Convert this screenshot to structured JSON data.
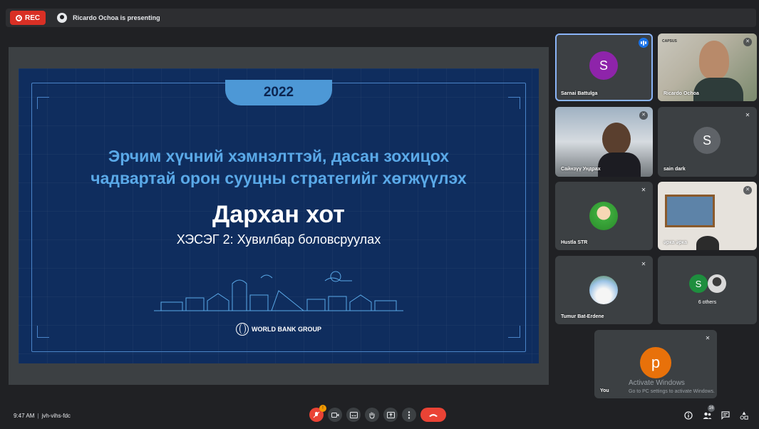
{
  "topbar": {
    "rec_label": "REC",
    "presenting_text": "Ricardo Ochoa is presenting"
  },
  "slide": {
    "year": "2022",
    "title_line1": "Эрчим хүчний хэмнэлттэй, дасан зохицох",
    "title_line2": "чадвартай орон сууцны стратегийг хөгжүүлэх",
    "city": "Дархан хот",
    "subtitle": "ХЭСЭГ 2: Хувилбар боловсруулах",
    "logo_text": "WORLD BANK GROUP"
  },
  "participants": [
    {
      "name": "Sarnai Battulga",
      "initial": "S",
      "avatar_color": "#8e24aa",
      "status": "speaking"
    },
    {
      "name": "Ricardo Ochoa",
      "status": "muted",
      "overlay_text": "CAPSUS"
    },
    {
      "name": "Сайнзүү Ундрах",
      "status": "muted"
    },
    {
      "name": "sain dark",
      "initial": "S",
      "avatar_color": "#5f6368",
      "status": "muted"
    },
    {
      "name": "Hustla STR",
      "status": "muted"
    },
    {
      "name": "әрка әрка",
      "status": "muted"
    },
    {
      "name": "Tumur Bat-Erdene",
      "status": "muted"
    },
    {
      "name": "6 others",
      "initial": "S",
      "avatar_color": "#1e8e3e"
    },
    {
      "name": "You",
      "initial": "p",
      "avatar_color": "#e8710a",
      "status": "muted"
    }
  ],
  "watermark": {
    "line1": "Activate Windows",
    "line2": "Go to PC settings to activate Windows."
  },
  "bottombar": {
    "time": "9:47 AM",
    "separator": "|",
    "meeting_code": "jvh-vihs-fdc",
    "mic_badge": "!",
    "people_count": "16"
  },
  "icons": {
    "mic": "mic-off-icon",
    "camera": "camera-icon",
    "captions": "captions-icon",
    "hand": "raise-hand-icon",
    "present": "present-icon",
    "more": "more-vert-icon",
    "hangup": "hang-up-icon",
    "info": "info-icon",
    "people": "people-icon",
    "chat": "chat-icon",
    "activities": "activities-icon"
  },
  "colors": {
    "background": "#202124",
    "slide_bg": "#0f2d5e",
    "slide_accent": "#4d98d6",
    "rec_red": "#d93025",
    "hangup_red": "#ea4335",
    "speaking_blue": "#1a73e8"
  }
}
